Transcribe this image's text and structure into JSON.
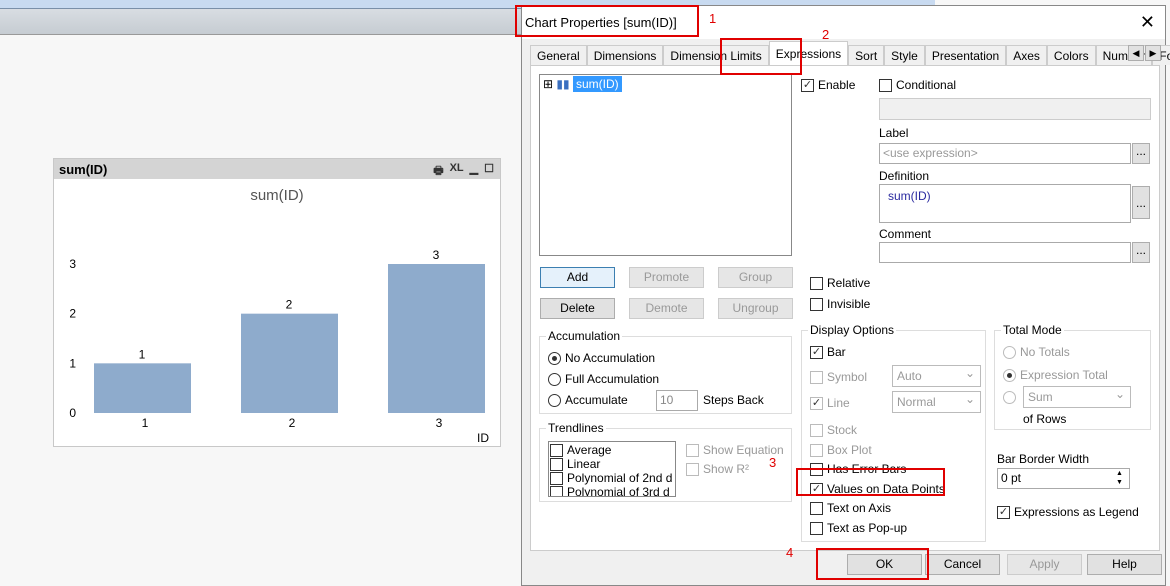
{
  "chart_window": {
    "caption": "sum(ID)",
    "icons": [
      "print-icon",
      "xl-icon",
      "minimize-icon",
      "maximize-icon"
    ],
    "xl_label": "XL"
  },
  "chart_data": {
    "type": "bar",
    "title": "sum(ID)",
    "categories": [
      "1",
      "2",
      "3"
    ],
    "values": [
      1,
      2,
      3
    ],
    "data_labels": [
      "1",
      "2",
      "3"
    ],
    "xlabel": "ID",
    "ylabel": "",
    "yticks": [
      "0",
      "1",
      "2",
      "3"
    ],
    "ylim": [
      0,
      3
    ],
    "bar_color": "#8eabcc",
    "grid": false
  },
  "dialog": {
    "title": "Chart Properties [sum(ID)]",
    "close": "✕",
    "tabs": [
      "General",
      "Dimensions",
      "Dimension Limits",
      "Expressions",
      "Sort",
      "Style",
      "Presentation",
      "Axes",
      "Colors",
      "Number",
      "Font"
    ],
    "active_tab": "Expressions",
    "expression_tree": {
      "item": "sum(ID)",
      "expand": "⊞"
    },
    "enable": "Enable",
    "conditional": "Conditional",
    "label_title": "Label",
    "label_placeholder": "<use expression>",
    "definition_title": "Definition",
    "definition": "sum(ID)",
    "comment_title": "Comment",
    "ellipsis": "...",
    "buttons": {
      "add": "Add",
      "promote": "Promote",
      "group": "Group",
      "delete": "Delete",
      "demote": "Demote",
      "ungroup": "Ungroup"
    },
    "relative": "Relative",
    "invisible": "Invisible",
    "accumulation": {
      "title": "Accumulation",
      "options": [
        "No Accumulation",
        "Full Accumulation",
        "Accumulate"
      ],
      "steps": "10",
      "steps_label": "Steps Back"
    },
    "trendlines": {
      "title": "Trendlines",
      "items": [
        "Average",
        "Linear",
        "Polynomial of 2nd d",
        "Polynomial of 3rd d"
      ],
      "show_equation": "Show Equation",
      "show_r2": "Show R²"
    },
    "display": {
      "title": "Display Options",
      "bar": "Bar",
      "symbol": "Symbol",
      "symbol_value": "Auto",
      "line": "Line",
      "line_value": "Normal",
      "stock": "Stock",
      "box_plot": "Box Plot",
      "error_bars": "Has Error Bars",
      "values_on_points": "Values on Data Points",
      "text_on_axis": "Text on Axis",
      "text_popup": "Text as Pop-up"
    },
    "total_mode": {
      "title": "Total Mode",
      "no_totals": "No Totals",
      "expression_total": "Expression Total",
      "sum": "Sum",
      "of_rows": "of Rows"
    },
    "bar_border": {
      "title": "Bar Border Width",
      "value": "0 pt"
    },
    "expressions_legend": "Expressions as Legend",
    "footer": {
      "ok": "OK",
      "cancel": "Cancel",
      "apply": "Apply",
      "help": "Help"
    },
    "annotations": [
      "1",
      "2",
      "3",
      "4"
    ]
  }
}
